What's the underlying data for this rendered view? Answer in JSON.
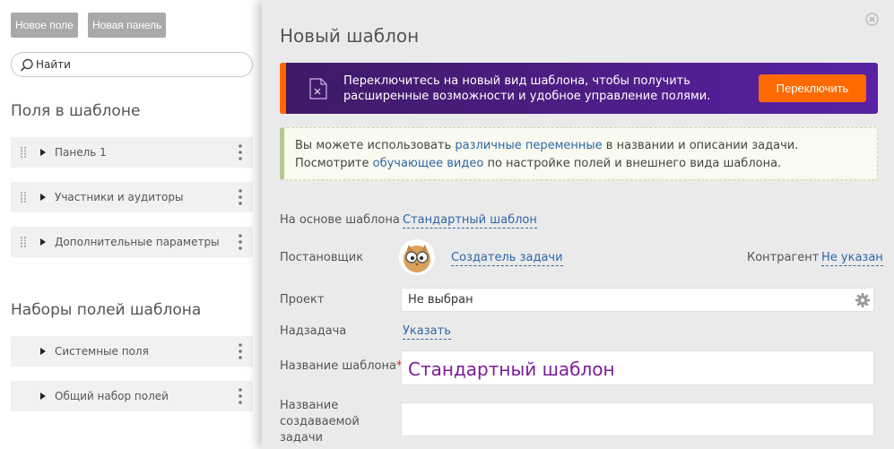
{
  "left": {
    "buttons": {
      "new_field": "Новое поле",
      "new_panel": "Новая панель"
    },
    "search": {
      "placeholder": "Найти"
    },
    "section_fields_title": "Поля в шаблоне",
    "fields": [
      {
        "label": "Панель 1"
      },
      {
        "label": "Участники и аудиторы"
      },
      {
        "label": "Дополнительные параметры"
      }
    ],
    "section_sets_title": "Наборы полей шаблона",
    "sets": [
      {
        "label": "Системные поля"
      },
      {
        "label": "Общий набор полей"
      }
    ]
  },
  "right": {
    "title": "Новый шаблон",
    "banner": {
      "text": "Переключитесь на новый вид шаблона, чтобы получить расширенные возможности и удобное управление полями.",
      "button": "Переключить",
      "stripe_color": "#ff6a00",
      "bg_color": "#4d1d84"
    },
    "info": {
      "t1": "Вы можете использовать ",
      "l1": "различные переменные",
      "t2": " в названии и описании задачи. Посмотрите ",
      "l2": "обучающее видео",
      "t3": " по настройке полей и внешнего вида шаблона."
    },
    "form": {
      "base_label": "На основе шаблона",
      "base_value": "Стандартный шаблон",
      "author_label": "Постановщик",
      "author_value": "Создатель задачи",
      "contractor_label": "Контрагент",
      "contractor_value": "Не указан",
      "project_label": "Проект",
      "project_value": "Не выбран",
      "parent_label": "Надзадача",
      "parent_value": "Указать",
      "name_label": "Название шаблона",
      "name_value": "Стандартный шаблон",
      "task_name_label_1": "Название",
      "task_name_label_2": "создаваемой",
      "task_name_label_3": "задачи"
    }
  }
}
